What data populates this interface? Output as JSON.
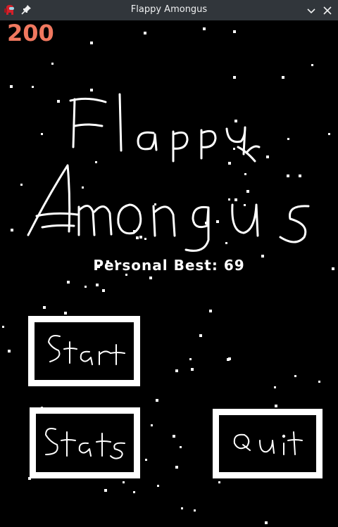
{
  "window": {
    "title": "Flappy Amongus"
  },
  "hud": {
    "score": "200"
  },
  "logo": {
    "line1": "Flappy",
    "line2": "Amongus"
  },
  "menu": {
    "personal_best": "Personal Best: 69",
    "start_label": "Start",
    "stats_label": "Stats",
    "quit_label": "Quit"
  },
  "icons": {
    "app": "amongus-crewmate-icon",
    "pin": "pin-icon",
    "minimize": "chevron-down-icon",
    "close": "close-icon"
  },
  "colors": {
    "titlebar": "#31363b",
    "background": "#000000",
    "score": "#f0785f",
    "ink": "#ffffff"
  }
}
